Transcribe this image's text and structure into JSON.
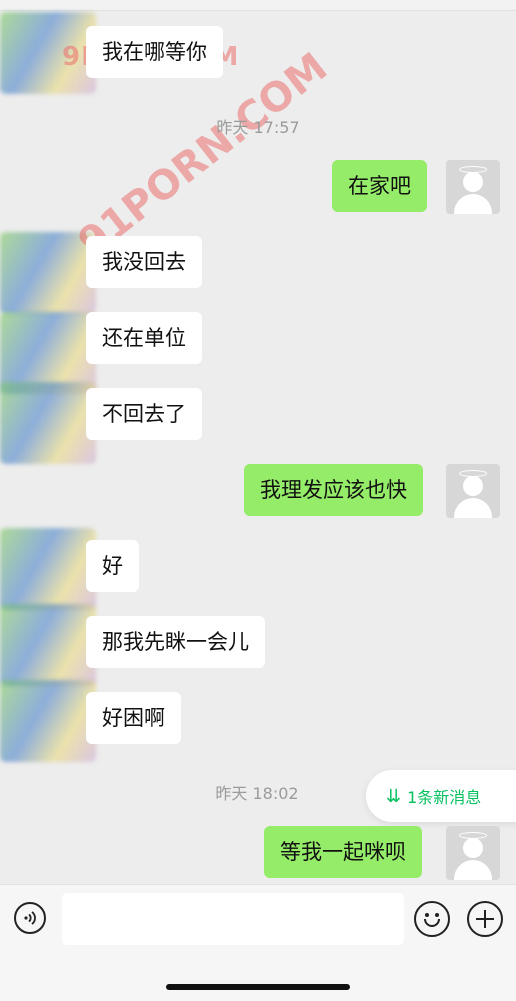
{
  "messages": [
    {
      "text": "我在哪等你",
      "side": "in"
    },
    {
      "text": "在家吧",
      "side": "out"
    },
    {
      "text": "我没回去",
      "side": "in"
    },
    {
      "text": "还在单位",
      "side": "in"
    },
    {
      "text": "不回去了",
      "side": "in"
    },
    {
      "text": "我理发应该也快",
      "side": "out"
    },
    {
      "text": "好",
      "side": "in"
    },
    {
      "text": "那我先眯一会儿",
      "side": "in"
    },
    {
      "text": "好困啊",
      "side": "in"
    },
    {
      "text": "等我一起咪呗",
      "side": "out"
    }
  ],
  "timestamps": [
    "昨天 17:57",
    "昨天 18:02"
  ],
  "new_messages_pill": {
    "label": "1条新消息",
    "icon": "double-chevron-down-icon"
  },
  "watermarks": [
    "9P606.COM",
    "91PORN.COM"
  ],
  "input_bar": {
    "placeholder": ""
  },
  "colors": {
    "background": "#ededed",
    "outgoing_bubble": "#95ec69",
    "incoming_bubble": "#ffffff",
    "accent": "#07c160",
    "timestamp": "#9b9b9b"
  }
}
